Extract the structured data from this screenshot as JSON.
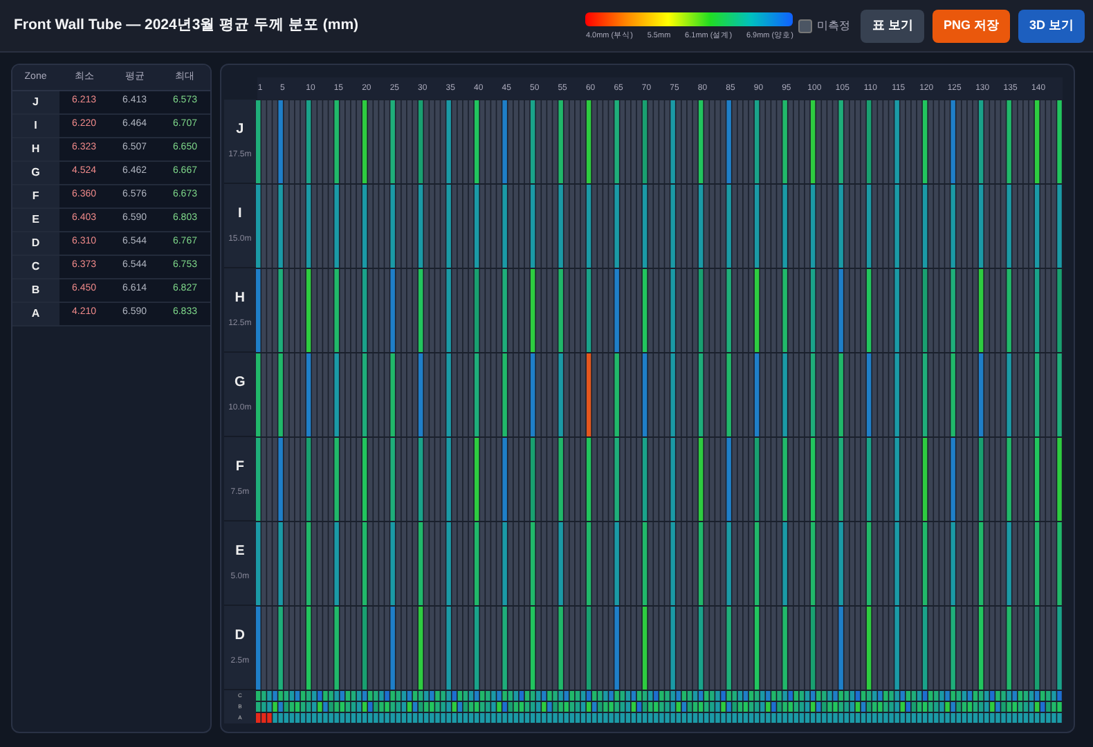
{
  "header": {
    "title": "Front Wall Tube — 2024년3월 평균 두께 분포 (mm)",
    "legend": {
      "labels": [
        "4.0mm (부식)",
        "5.5mm",
        "6.1mm (설계)",
        "6.9mm (양호)"
      ]
    },
    "unmeasured": {
      "label": "미측정",
      "checked": false
    },
    "buttons": [
      {
        "label": "표 보기",
        "kind": "secondary"
      },
      {
        "label": "PNG 저장",
        "kind": "warning"
      },
      {
        "label": "3D 보기",
        "kind": "primary"
      }
    ]
  },
  "summary_table": {
    "columns": [
      "Zone",
      "최소",
      "평균",
      "최대"
    ],
    "rows": [
      [
        "J",
        "6.213",
        "6.413",
        "6.573"
      ],
      [
        "I",
        "6.220",
        "6.464",
        "6.707"
      ],
      [
        "H",
        "6.323",
        "6.507",
        "6.650"
      ],
      [
        "G",
        "4.524",
        "6.462",
        "6.667"
      ],
      [
        "F",
        "6.360",
        "6.576",
        "6.673"
      ],
      [
        "E",
        "6.403",
        "6.590",
        "6.803"
      ],
      [
        "D",
        "6.310",
        "6.544",
        "6.767"
      ],
      [
        "C",
        "6.373",
        "6.544",
        "6.753"
      ],
      [
        "B",
        "6.450",
        "6.614",
        "6.827"
      ],
      [
        "A",
        "4.210",
        "6.590",
        "6.833"
      ]
    ]
  },
  "heatmap": {
    "column_labels": [
      "1",
      "5",
      "10",
      "15",
      "20",
      "25",
      "30",
      "35",
      "40",
      "45",
      "50",
      "55",
      "60",
      "65",
      "70",
      "75",
      "80",
      "85",
      "90",
      "95",
      "100",
      "105",
      "110",
      "115",
      "120",
      "125",
      "130",
      "135",
      "140"
    ],
    "zones": [
      {
        "label": "J",
        "height": "17.5m",
        "kind": "main"
      },
      {
        "label": "I",
        "height": "15.0m",
        "kind": "main"
      },
      {
        "label": "H",
        "height": "12.5m",
        "kind": "main"
      },
      {
        "label": "G",
        "height": "10.0m",
        "kind": "main"
      },
      {
        "label": "F",
        "height": "7.5m",
        "kind": "main"
      },
      {
        "label": "E",
        "height": "5.0m",
        "kind": "main"
      },
      {
        "label": "D",
        "height": "2.5m",
        "kind": "main"
      },
      {
        "label": "C",
        "kind": "thin"
      },
      {
        "label": "B",
        "kind": "thin"
      },
      {
        "label": "A",
        "kind": "thin"
      }
    ]
  }
}
